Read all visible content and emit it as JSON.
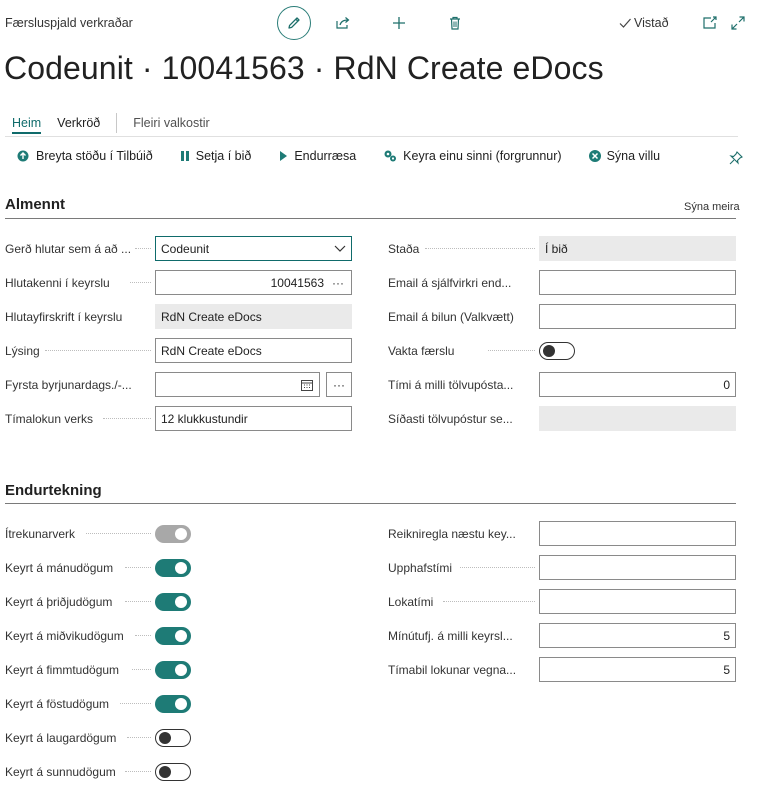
{
  "header": {
    "caption": "Færsluspjald verkraðar",
    "saved_label": "Vistað",
    "title": "Codeunit · 10041563 · RdN Create eDocs"
  },
  "tabs": [
    {
      "label": "Heim"
    },
    {
      "label": "Verkröð"
    },
    {
      "label": "Fleiri valkostir"
    }
  ],
  "actions": [
    {
      "label": "Breyta stöðu í Tilbúið",
      "icon": "status-change-icon"
    },
    {
      "label": "Setja í bið",
      "icon": "pause-icon"
    },
    {
      "label": "Endurræsa",
      "icon": "play-icon"
    },
    {
      "label": "Keyra einu sinni (forgrunnur)",
      "icon": "run-once-icon"
    },
    {
      "label": "Sýna villu",
      "icon": "error-icon"
    }
  ],
  "general": {
    "title": "Almennt",
    "show_more": "Sýna meira",
    "object_type": {
      "label": "Gerð hlutar sem á að ...",
      "value": "Codeunit"
    },
    "object_id": {
      "label": "Hlutakenni í keyrslu",
      "value": "10041563"
    },
    "object_caption": {
      "label": "Hlutayfirskrift í keyrslu",
      "value": "RdN Create eDocs"
    },
    "description": {
      "label": "Lýsing",
      "value": "RdN Create eDocs"
    },
    "earliest_start": {
      "label": "Fyrsta byrjunardags./-...",
      "value": ""
    },
    "job_timeout": {
      "label": "Tímalokun verks",
      "value": "12 klukkustundir"
    },
    "status": {
      "label": "Staða",
      "value": "Í bið"
    },
    "email_on_auto_end": {
      "label": "Email á sjálfvirkri end...",
      "value": ""
    },
    "email_on_error": {
      "label": "Email á bilun (Valkvætt)",
      "value": ""
    },
    "log_entries": {
      "label": "Vakta færslu",
      "value": false
    },
    "time_between_emails": {
      "label": "Tími á milli tölvupósta...",
      "value": "0"
    },
    "last_email_sent": {
      "label": "Síðasti tölvupóstur se...",
      "value": ""
    }
  },
  "recurrence": {
    "title": "Endurtekning",
    "days": [
      {
        "label": "Ítrekunarverk",
        "value": true,
        "disabled": true
      },
      {
        "label": "Keyrt á mánudögum",
        "value": true
      },
      {
        "label": "Keyrt á þriðjudögum",
        "value": true
      },
      {
        "label": "Keyrt á miðvikudögum",
        "value": true
      },
      {
        "label": "Keyrt á fimmtudögum",
        "value": true
      },
      {
        "label": "Keyrt á föstudögum",
        "value": true
      },
      {
        "label": "Keyrt á laugardögum",
        "value": false
      },
      {
        "label": "Keyrt á sunnudögum",
        "value": false
      }
    ],
    "next_run_formula": {
      "label": "Reikniregla næstu key...",
      "value": ""
    },
    "start_time": {
      "label": "Upphafstími",
      "value": ""
    },
    "end_time": {
      "label": "Lokatími",
      "value": ""
    },
    "minutes_between_runs": {
      "label": "Mínútufj. á milli keyrsl...",
      "value": "5"
    },
    "inactivity_timeout": {
      "label": "Tímabil lokunar vegna...",
      "value": "5"
    }
  },
  "colors": {
    "accent": "#0f6b6b",
    "toggle_on": "#1e7b76",
    "readonly_bg": "#eaeaea"
  }
}
